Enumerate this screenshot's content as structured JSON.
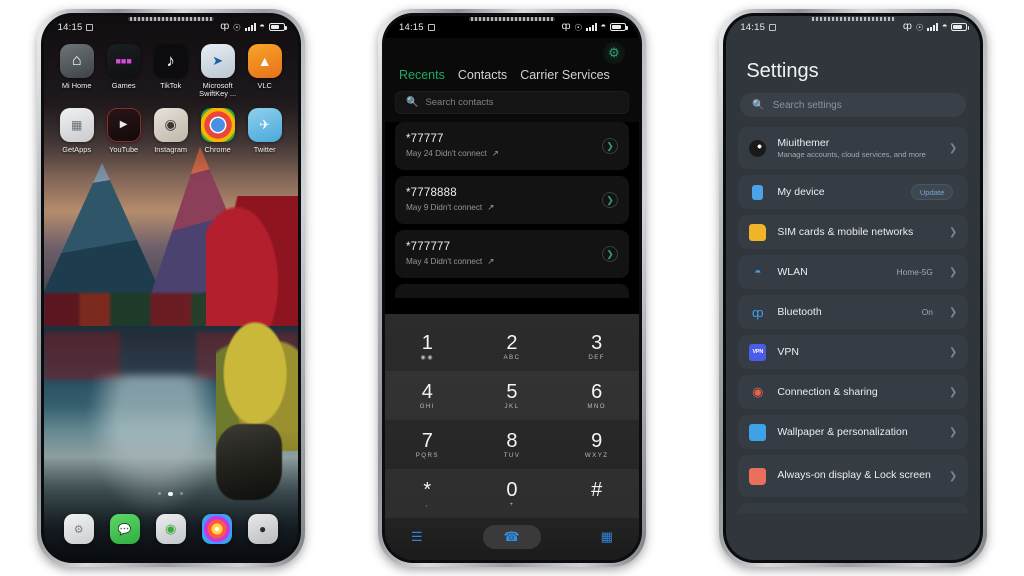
{
  "status_bar": {
    "time": "14:15",
    "icons": [
      "alarm-icon",
      "bluetooth-icon",
      "mute-icon",
      "signal-icon",
      "wifi-icon",
      "battery-icon"
    ]
  },
  "colors": {
    "accent_green": "#1faa62",
    "accent_blue": "#2e8ee0",
    "settings_bg": "#31363c",
    "settings_row": "#363c43",
    "dialer_bg": "#000000"
  },
  "phone1_home": {
    "rows": [
      [
        {
          "label": "Mi Home",
          "icon": "mi-home-icon"
        },
        {
          "label": "Games",
          "icon": "games-icon"
        },
        {
          "label": "TikTok",
          "icon": "tiktok-icon"
        },
        {
          "label": "Microsoft SwiftKey ...",
          "icon": "swiftkey-icon"
        },
        {
          "label": "VLC",
          "icon": "vlc-icon"
        }
      ],
      [
        {
          "label": "GetApps",
          "icon": "getapps-icon"
        },
        {
          "label": "YouTube",
          "icon": "youtube-icon"
        },
        {
          "label": "Instagram",
          "icon": "instagram-icon"
        },
        {
          "label": "Chrome",
          "icon": "chrome-icon"
        },
        {
          "label": "Twitter",
          "icon": "twitter-icon"
        }
      ]
    ],
    "page_dots": {
      "count": 3,
      "active_index": 1
    },
    "dock": [
      {
        "name": "settings-icon"
      },
      {
        "name": "messages-icon"
      },
      {
        "name": "toggle-icon"
      },
      {
        "name": "gallery-icon"
      },
      {
        "name": "camera-icon"
      }
    ],
    "wallpaper": "mountain-lake-autumn-wallpaper"
  },
  "phone2_dialer": {
    "settings_icon": "gear-icon",
    "tabs": [
      {
        "label": "Recents",
        "active": true
      },
      {
        "label": "Contacts",
        "active": false
      },
      {
        "label": "Carrier Services",
        "active": false
      }
    ],
    "search": {
      "placeholder": "Search contacts",
      "icon": "search-icon"
    },
    "calls": [
      {
        "number": "*77777",
        "detail": "May 24 Didn't connect"
      },
      {
        "number": "*7778888",
        "detail": "May 9 Didn't connect"
      },
      {
        "number": "*777777",
        "detail": "May 4 Didn't connect"
      }
    ],
    "keypad": [
      [
        {
          "digit": "1",
          "sub": ""
        },
        {
          "digit": "2",
          "sub": "ABC"
        },
        {
          "digit": "3",
          "sub": "DEF"
        }
      ],
      [
        {
          "digit": "4",
          "sub": "GHI"
        },
        {
          "digit": "5",
          "sub": "JKL"
        },
        {
          "digit": "6",
          "sub": "MNO"
        }
      ],
      [
        {
          "digit": "7",
          "sub": "PQRS"
        },
        {
          "digit": "8",
          "sub": "TUV"
        },
        {
          "digit": "9",
          "sub": "WXYZ"
        }
      ],
      [
        {
          "digit": "*",
          "sub": ","
        },
        {
          "digit": "0",
          "sub": "+"
        },
        {
          "digit": "#",
          "sub": ""
        }
      ]
    ],
    "bottom_bar": {
      "left_icon": "menu-icon",
      "call_icon": "call-icon",
      "right_icon": "dialpad-icon"
    }
  },
  "phone3_settings": {
    "title": "Settings",
    "search": {
      "placeholder": "Search settings",
      "icon": "search-icon"
    },
    "items": [
      {
        "label": "Miuithemer",
        "desc": "Manage accounts, cloud services, and more",
        "value": "",
        "badge": "",
        "icon": "account-avatar-icon"
      },
      {
        "label": "My device",
        "desc": "",
        "value": "",
        "badge": "Update",
        "icon": "device-icon"
      },
      {
        "label": "SIM cards & mobile networks",
        "desc": "",
        "value": "",
        "badge": "",
        "icon": "sim-card-icon"
      },
      {
        "label": "WLAN",
        "desc": "",
        "value": "Home-5G",
        "badge": "",
        "icon": "wifi-icon"
      },
      {
        "label": "Bluetooth",
        "desc": "",
        "value": "On",
        "badge": "",
        "icon": "bluetooth-icon"
      },
      {
        "label": "VPN",
        "desc": "",
        "value": "",
        "badge": "",
        "icon": "vpn-icon"
      },
      {
        "label": "Connection & sharing",
        "desc": "",
        "value": "",
        "badge": "",
        "icon": "connection-sharing-icon"
      },
      {
        "label": "Wallpaper & personalization",
        "desc": "",
        "value": "",
        "badge": "",
        "icon": "wallpaper-icon"
      },
      {
        "label": "Always-on display & Lock screen",
        "desc": "",
        "value": "",
        "badge": "",
        "icon": "lock-icon"
      }
    ]
  }
}
